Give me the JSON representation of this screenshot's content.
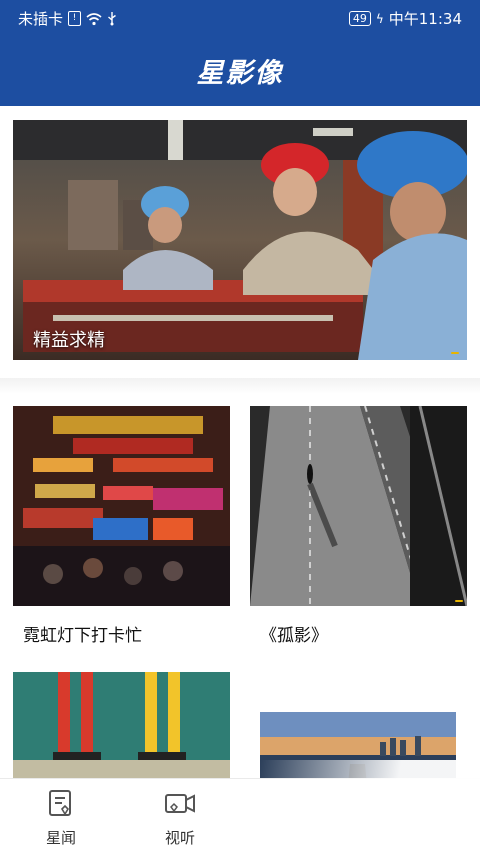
{
  "status": {
    "carrier": "未插卡",
    "battery": "49",
    "time": "中午11:34"
  },
  "header": {
    "title": "星影像"
  },
  "hero": {
    "caption": "精益求精"
  },
  "grid": [
    {
      "title": "霓虹灯下打卡忙"
    },
    {
      "title": "《孤影》"
    },
    {
      "title": ""
    },
    {
      "title": ""
    }
  ],
  "tabs": [
    {
      "label": "星闻",
      "icon": "news-icon"
    },
    {
      "label": "视听",
      "icon": "video-icon"
    }
  ],
  "colors": {
    "brand": "#1d4ea1",
    "background": "#ffffff"
  }
}
